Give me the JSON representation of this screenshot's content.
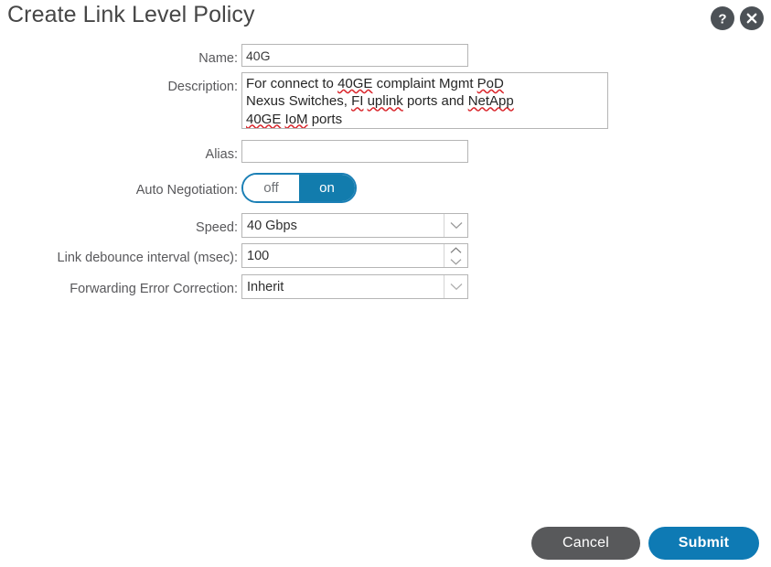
{
  "dialog": {
    "title": "Create Link Level Policy",
    "help_icon": "help-icon",
    "close_icon": "close-icon"
  },
  "form": {
    "name": {
      "label": "Name:",
      "value": "40G",
      "placeholder": ""
    },
    "description": {
      "label": "Description:",
      "value": "For connect to 40GE complaint Mgmt PoD Nexus Switches, FI uplink ports and NetApp 40GE IoM ports",
      "placeholder": "",
      "lines": [
        "For connect to 40GE complaint Mgmt PoD",
        "Nexus Switches, FI uplink ports and NetApp",
        "40GE IoM ports"
      ],
      "misspelled_words": [
        "40GE",
        "PoD",
        "FI",
        "uplink",
        "NetApp",
        "IoM"
      ]
    },
    "alias": {
      "label": "Alias:",
      "value": "",
      "placeholder": ""
    },
    "auto_negotiation": {
      "label": "Auto Negotiation:",
      "off_label": "off",
      "on_label": "on",
      "selected": "on"
    },
    "speed": {
      "label": "Speed:",
      "value": "40 Gbps",
      "options": [
        "40 Gbps"
      ]
    },
    "link_debounce": {
      "label": "Link debounce interval (msec):",
      "value": "100"
    },
    "fec": {
      "label": "Forwarding Error Correction:",
      "value": "Inherit",
      "options": [
        "Inherit"
      ]
    }
  },
  "footer": {
    "cancel_label": "Cancel",
    "submit_label": "Submit"
  },
  "colors": {
    "accent_blue": "#0e7ab4",
    "toggle_blue": "#127cad",
    "cancel_gray": "#58595b",
    "icon_gray": "#4c5156",
    "label_gray": "#58585b",
    "border_gray": "#b5b5b5",
    "spellcheck_red": "#d9242a"
  }
}
